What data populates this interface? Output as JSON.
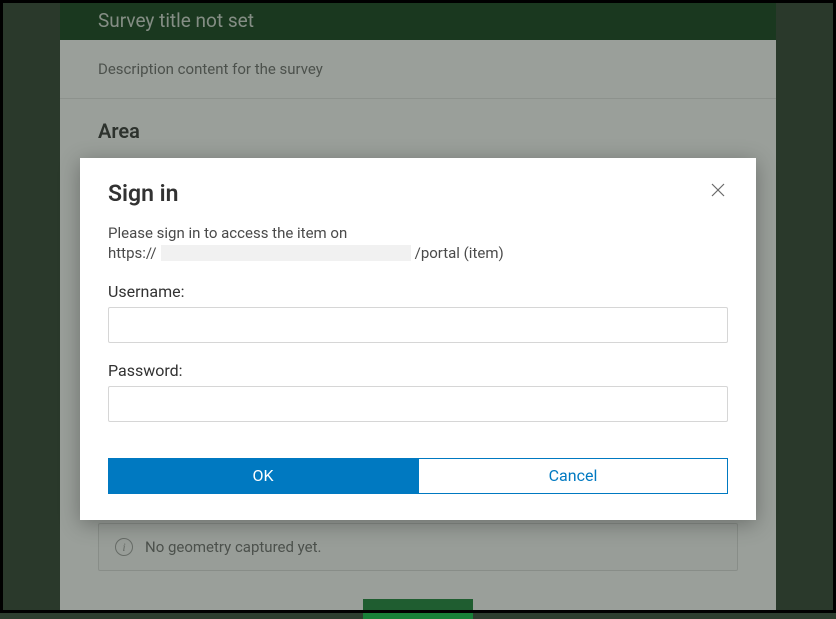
{
  "survey": {
    "title": "Survey title not set",
    "description": "Description content for the survey",
    "area_heading": "Area",
    "geometry_status": "No geometry captured yet."
  },
  "modal": {
    "title": "Sign in",
    "message_line1": "Please sign in to access the item on",
    "url_prefix": "https://",
    "url_suffix": "/portal (item)",
    "username_label": "Username:",
    "password_label": "Password:",
    "username_value": "",
    "password_value": "",
    "ok_label": "OK",
    "cancel_label": "Cancel"
  }
}
